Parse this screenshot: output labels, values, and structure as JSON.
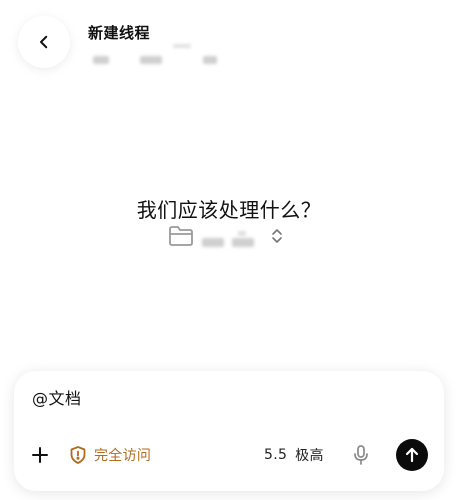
{
  "header": {
    "title": "新建线程",
    "back_icon": "chevron-left-icon"
  },
  "main": {
    "prompt": "我们应该处理什么？",
    "project_icon": "folder-icon",
    "project_switch_icon": "chevron-updown-icon"
  },
  "composer": {
    "input_value": "@文档",
    "access_label": "完全访问",
    "model_version": "5.5",
    "model_effort": "极高",
    "icons": {
      "add": "plus-icon",
      "access": "shield-warning-icon",
      "mic": "microphone-icon",
      "send": "arrow-up-icon"
    },
    "colors": {
      "access": "#b26a1f",
      "send_bg": "#0b0b0b"
    }
  }
}
